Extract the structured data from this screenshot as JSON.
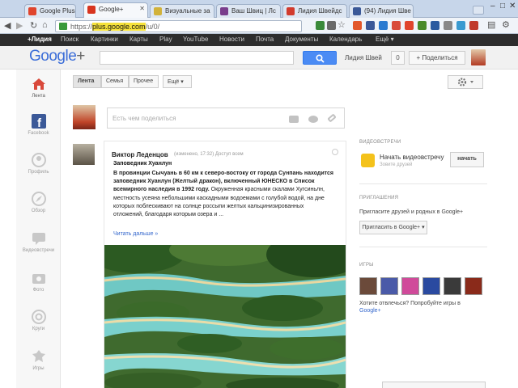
{
  "browser": {
    "tabs": [
      {
        "label": "Google Plus Ho",
        "color": "#e0452d"
      },
      {
        "label": "Google+",
        "color": "#d8351f"
      },
      {
        "label": "Визуальные за",
        "color": "#d2b23a"
      },
      {
        "label": "Ваш Швиц | Лс",
        "color": "#7a3d8c"
      },
      {
        "label": "Лидия Швейдс",
        "color": "#d23b2d"
      },
      {
        "label": "(94) Лидия Шве",
        "color": "#3b5998"
      }
    ],
    "url_prefix": "https://",
    "url_domain": "plus.google.com",
    "url_path": "/u/0/"
  },
  "gbar": {
    "items": [
      "+Лидия",
      "Поиск",
      "Картинки",
      "Карты",
      "Play",
      "YouTube",
      "Новости",
      "Почта",
      "Документы",
      "Календарь",
      "Ещё ▾"
    ]
  },
  "header": {
    "logo_text": "Google",
    "logo_plus": "+",
    "username": "Лидия Швей",
    "notifications": "0",
    "share_button": "+ Поделиться"
  },
  "leftnav": {
    "items": [
      {
        "label": "Лента",
        "icon": "home-icon"
      },
      {
        "label": "Facebook",
        "icon": "facebook-icon"
      },
      {
        "label": "Профиль",
        "icon": "profile-icon"
      },
      {
        "label": "Обзор",
        "icon": "explore-icon"
      },
      {
        "label": "Видеовстречи",
        "icon": "hangouts-icon"
      },
      {
        "label": "Фото",
        "icon": "photos-icon"
      },
      {
        "label": "Круги",
        "icon": "circles-icon"
      },
      {
        "label": "Игры",
        "icon": "games-icon"
      }
    ]
  },
  "stream": {
    "tabs": [
      "Лента",
      "Семья",
      "Прочее",
      "Ещё ▾"
    ],
    "share_placeholder": "Есть чем поделиться"
  },
  "post": {
    "author": "Виктор Леденцов",
    "meta": "(изменено, 17:32)  Доступ всем",
    "title": "Заповедник Хуанлун",
    "body_bold": "В провинции Сычуань в 60 км к северо-востоку от города Сунпань находится заповедник Хуанлун (Желтый дракон), включенный ЮНЕСКО в Список всемирного наследия в 1992 году.",
    "body_normal": " Окруженная красными скалами Хугсиньлн, местность усеяна небольшими каскадными водоемами с голубой водой, на дне которых поблескивают на солнце россыпи желтых кальцинизированных отложений, благодаря которым озера и ...",
    "read_more": "Читать дальше »"
  },
  "right": {
    "hangouts_header": "ВИДЕОВСТРЕЧИ",
    "hangout_text": "Начать видеовстречу",
    "hangout_sub": "Зовите друзей",
    "start_button": "начать",
    "invite_header": "ПРИГЛАШЕНИЯ",
    "invite_text": "Пригласите друзей и родных в Google+",
    "invite_button": "Пригласить в Google+ ▾",
    "games_header": "ИГРЫ",
    "games_text": "Хотите отвлечься? Попробуйте игры в ",
    "games_link": "Google+",
    "game_tiles": [
      "#6b4a3a",
      "#4a5aa8",
      "#d04a9a",
      "#2a4aa0",
      "#3a3a3a",
      "#8a2a1a"
    ]
  },
  "colors": {
    "accent_blue": "#4b8bf4",
    "gbar_bg": "#2d2d2d",
    "link": "#3366cc"
  }
}
